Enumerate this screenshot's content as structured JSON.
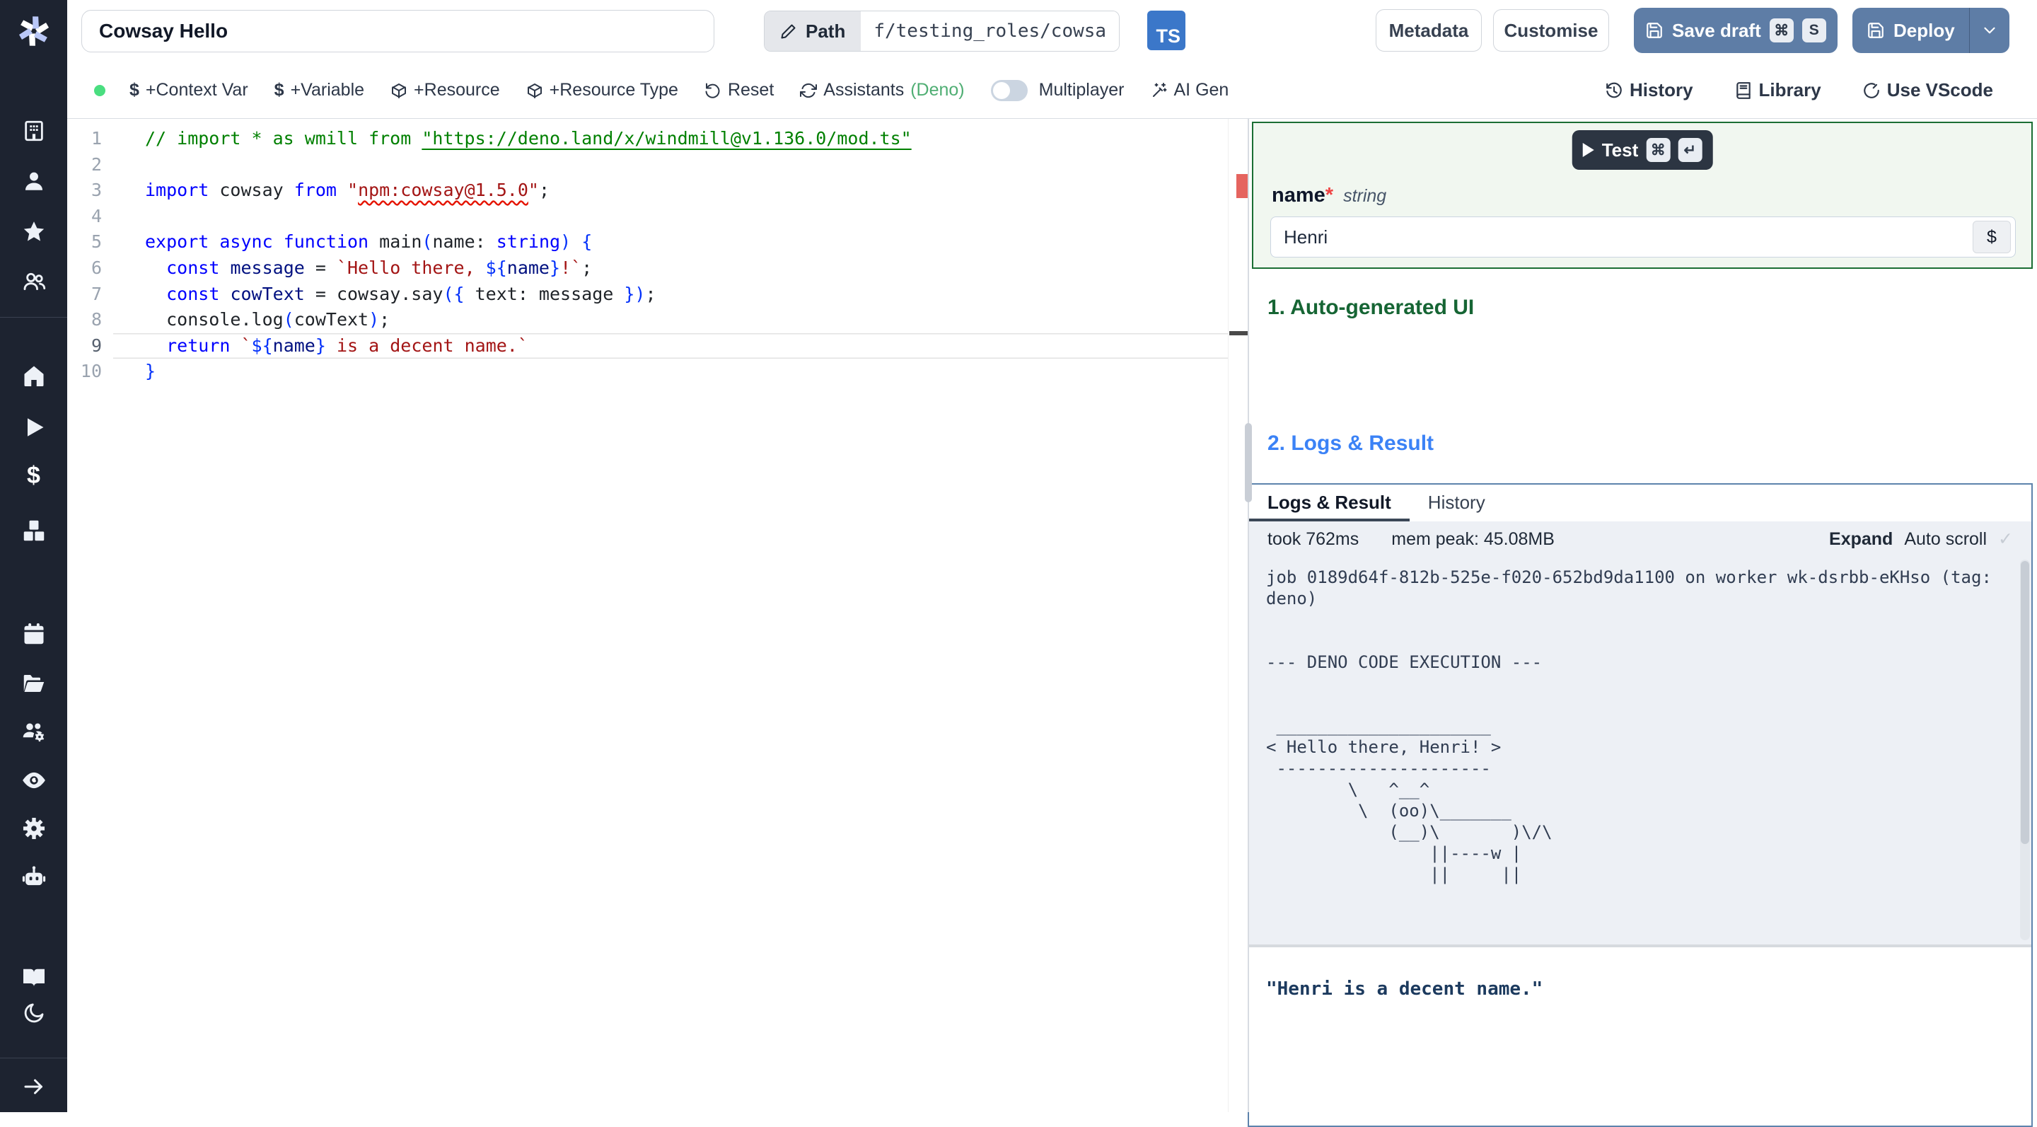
{
  "colors": {
    "accent_button": "#5e7da6",
    "ts_badge": "#3b77c9",
    "live_dot_green": "#4ade80",
    "deno_green": "#4fae73",
    "heading_green": "#166534",
    "heading_blue": "#3b82f6",
    "schema_border_green": "#1b6e34",
    "logs_border_blue": "#5d83ac",
    "error_red": "#e5645f",
    "sidebar_bg": "#1d2330"
  },
  "sidebar": {
    "icons": [
      "windmill-logo",
      "building",
      "user",
      "star",
      "users",
      "home",
      "play",
      "dollar",
      "cubes",
      "calendar",
      "folder-open",
      "users-cog",
      "eye",
      "gear",
      "robot",
      "book-open",
      "moon",
      "arrow-right"
    ]
  },
  "topbar": {
    "title_value": "Cowsay Hello",
    "path_label": "Path",
    "path_value": "f/testing_roles/cowsa",
    "lang_badge": "TS",
    "metadata_label": "Metadata",
    "customise_label": "Customise",
    "save_draft_label": "Save draft",
    "save_shortcut_keys": [
      "⌘",
      "S"
    ],
    "deploy_label": "Deploy"
  },
  "toolbar": {
    "context_var_label": "+Context Var",
    "variable_label": "+Variable",
    "resource_label": "+Resource",
    "resource_type_label": "+Resource Type",
    "reset_label": "Reset",
    "assistants_label": "Assistants",
    "assistants_lang": "(Deno)",
    "multiplayer_label": "Multiplayer",
    "ai_gen_label": "AI Gen",
    "history_label": "History",
    "library_label": "Library",
    "vscode_label": "Use VScode"
  },
  "editor": {
    "current_line": 9,
    "lines": [
      [
        [
          "c",
          "// import * as wmill from "
        ],
        [
          "cl",
          "\"https://deno.land/x/windmill@v1.136.0/mod.ts\""
        ]
      ],
      [],
      [
        [
          "k",
          "import"
        ],
        [
          "p",
          " cowsay "
        ],
        [
          "k",
          "from"
        ],
        [
          "p",
          " "
        ],
        [
          "s",
          "\""
        ],
        [
          "se",
          "npm:cowsay@1.5.0"
        ],
        [
          "s",
          "\""
        ],
        [
          "p",
          ";"
        ]
      ],
      [],
      [
        [
          "k",
          "export"
        ],
        [
          "p",
          " "
        ],
        [
          "k",
          "async"
        ],
        [
          "p",
          " "
        ],
        [
          "k",
          "function"
        ],
        [
          "p",
          " main"
        ],
        [
          "b",
          "("
        ],
        [
          "p",
          "name: "
        ],
        [
          "t",
          "string"
        ],
        [
          "b",
          ")"
        ],
        [
          "p",
          " "
        ],
        [
          "b",
          "{"
        ]
      ],
      [
        [
          "p",
          "  "
        ],
        [
          "k",
          "const"
        ],
        [
          "p",
          " "
        ],
        [
          "v",
          "message"
        ],
        [
          "p",
          " = "
        ],
        [
          "s",
          "`Hello there, "
        ],
        [
          "b",
          "${"
        ],
        [
          "v",
          "name"
        ],
        [
          "b",
          "}"
        ],
        [
          "s",
          "!`"
        ],
        [
          "p",
          ";"
        ]
      ],
      [
        [
          "p",
          "  "
        ],
        [
          "k",
          "const"
        ],
        [
          "p",
          " "
        ],
        [
          "v",
          "cowText"
        ],
        [
          "p",
          " = cowsay.say"
        ],
        [
          "b",
          "({"
        ],
        [
          "p",
          " text: message "
        ],
        [
          "b",
          "})"
        ],
        [
          "p",
          ";"
        ]
      ],
      [
        [
          "p",
          "  console.log"
        ],
        [
          "b",
          "("
        ],
        [
          "p",
          "cowText"
        ],
        [
          "b",
          ")"
        ],
        [
          "p",
          ";"
        ]
      ],
      [
        [
          "p",
          "  "
        ],
        [
          "k",
          "return"
        ],
        [
          "p",
          " "
        ],
        [
          "s",
          "`"
        ],
        [
          "b",
          "${"
        ],
        [
          "v",
          "name"
        ],
        [
          "b",
          "}"
        ],
        [
          "s",
          " is a decent name.`"
        ]
      ],
      [
        [
          "b",
          "}"
        ]
      ]
    ]
  },
  "right_panel": {
    "test_label": "Test",
    "test_shortcut_keys": [
      "⌘",
      "↵"
    ],
    "arg_name": "name",
    "arg_required_mark": "*",
    "arg_type": "string",
    "arg_value": "Henri",
    "var_picker_label": "$",
    "section1_title": "1. Auto-generated UI",
    "section2_title": "2. Logs & Result",
    "tabs": [
      "Logs & Result",
      "History"
    ],
    "active_tab": "Logs & Result",
    "stats": {
      "took": "took 762ms",
      "mem": "mem peak: 45.08MB",
      "expand_label": "Expand",
      "autoscroll_label": "Auto scroll"
    },
    "log_lines": [
      "job 0189d64f-812b-525e-f020-652bd9da1100 on worker wk-dsrbb-eKHso (tag:",
      "deno)",
      "",
      "",
      "--- DENO CODE EXECUTION ---",
      "",
      "",
      " _____________________",
      "< Hello there, Henri! >",
      " ---------------------",
      "        \\   ^__^",
      "         \\  (oo)\\_______",
      "            (__)\\       )\\/\\",
      "                ||----w |",
      "                ||     ||"
    ],
    "result_value": "\"Henri is a decent name.\""
  }
}
